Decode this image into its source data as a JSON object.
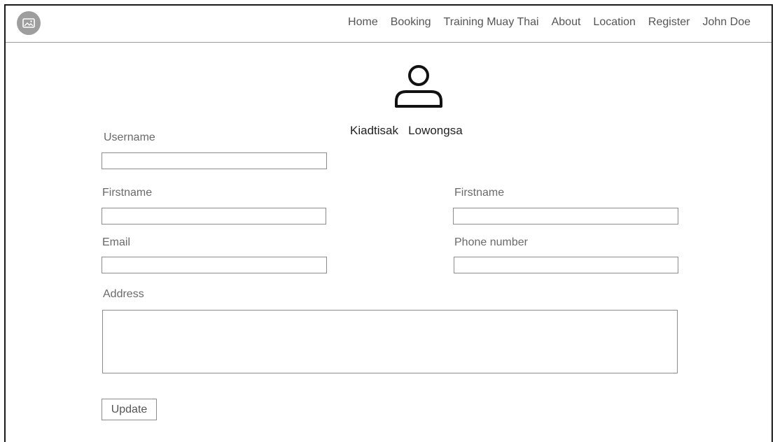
{
  "navbar": {
    "logo_icon": "image-icon",
    "links": [
      {
        "label": "Home"
      },
      {
        "label": "Booking"
      },
      {
        "label": "Training Muay Thai"
      },
      {
        "label": "About"
      },
      {
        "label": "Location"
      },
      {
        "label": "Register"
      },
      {
        "label": "John Doe"
      }
    ]
  },
  "profile": {
    "avatar_icon": "user-icon",
    "first_name": "Kiadtisak",
    "last_name": "Lowongsa"
  },
  "form": {
    "username": {
      "label": "Username",
      "value": ""
    },
    "firstname_left": {
      "label": "Firstname",
      "value": ""
    },
    "firstname_right": {
      "label": "Firstname",
      "value": ""
    },
    "email": {
      "label": "Email",
      "value": ""
    },
    "phone": {
      "label": "Phone number",
      "value": ""
    },
    "address": {
      "label": "Address",
      "value": ""
    },
    "submit_label": "Update"
  }
}
